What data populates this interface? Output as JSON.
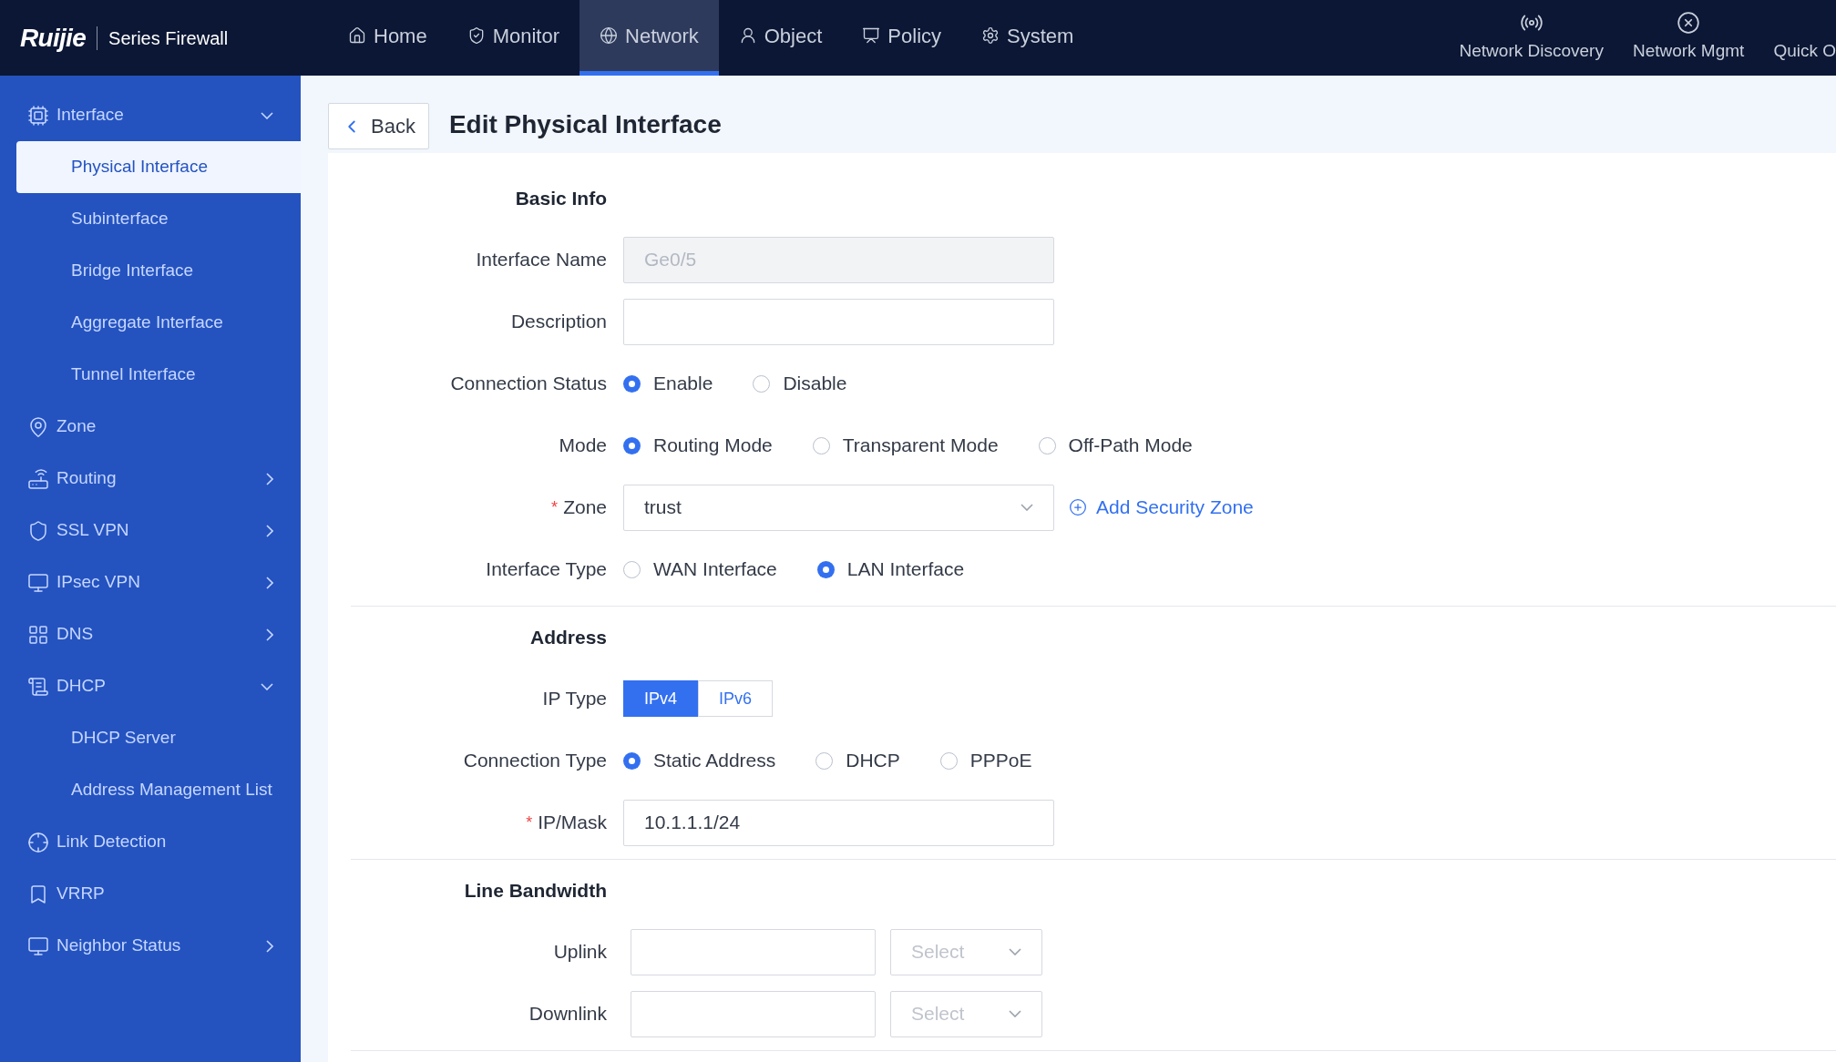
{
  "header": {
    "logo": "Ruijie",
    "product": "Series Firewall"
  },
  "nav_tabs": [
    {
      "label": "Home",
      "selected": false
    },
    {
      "label": "Monitor",
      "selected": false
    },
    {
      "label": "Network",
      "selected": true
    },
    {
      "label": "Object",
      "selected": false
    },
    {
      "label": "Policy",
      "selected": false
    },
    {
      "label": "System",
      "selected": false
    }
  ],
  "tools": [
    {
      "label": "Network Discovery"
    },
    {
      "label": "Network Mgmt"
    },
    {
      "label": "Quick O"
    }
  ],
  "sidebar": {
    "items": [
      {
        "label": "Interface",
        "kind": "menu",
        "expanded": true,
        "selected": false,
        "children": [
          {
            "label": "Physical Interface",
            "selected": true
          },
          {
            "label": "Subinterface",
            "selected": false
          },
          {
            "label": "Bridge Interface",
            "selected": false
          },
          {
            "label": "Aggregate Interface",
            "selected": false
          },
          {
            "label": "Tunnel Interface",
            "selected": false
          }
        ]
      },
      {
        "label": "Zone",
        "kind": "link",
        "selected": false
      },
      {
        "label": "Routing",
        "kind": "menu",
        "expanded": false,
        "selected": false
      },
      {
        "label": "SSL VPN",
        "kind": "menu",
        "expanded": false,
        "selected": false
      },
      {
        "label": "IPsec VPN",
        "kind": "menu",
        "expanded": false,
        "selected": false
      },
      {
        "label": "DNS",
        "kind": "menu",
        "expanded": false,
        "selected": false
      },
      {
        "label": "DHCP",
        "kind": "menu",
        "expanded": true,
        "selected": false,
        "children": [
          {
            "label": "DHCP Server",
            "selected": false
          },
          {
            "label": "Address Management List",
            "selected": false
          }
        ]
      },
      {
        "label": "Link Detection",
        "kind": "link",
        "selected": false
      },
      {
        "label": "VRRP",
        "kind": "link",
        "selected": false
      },
      {
        "label": "Neighbor Status",
        "kind": "menu",
        "expanded": false,
        "selected": false
      }
    ]
  },
  "page": {
    "back": "Back",
    "title": "Edit Physical Interface"
  },
  "sections": [
    {
      "title": "Basic Info",
      "fields": [
        {
          "kind": "text",
          "label": "Interface Name",
          "value": "Ge0/5",
          "disabled": true
        },
        {
          "kind": "text",
          "label": "Description",
          "disabled": false
        },
        {
          "kind": "radio",
          "label": "Connection Status",
          "options": [
            {
              "label": "Enable",
              "selected": true
            },
            {
              "label": "Disable",
              "selected": false
            }
          ]
        },
        {
          "kind": "radio",
          "label": "Mode",
          "options": [
            {
              "label": "Routing Mode",
              "selected": true
            },
            {
              "label": "Transparent Mode",
              "selected": false
            },
            {
              "label": "Off-Path Mode",
              "selected": false
            }
          ]
        },
        {
          "kind": "select",
          "label": "Zone",
          "required_mark": "*",
          "value": "trust",
          "link": "Add Security Zone"
        },
        {
          "kind": "radio",
          "label": "Interface Type",
          "options": [
            {
              "label": "WAN Interface",
              "selected": false
            },
            {
              "label": "LAN Interface",
              "selected": true
            }
          ]
        }
      ]
    },
    {
      "title": "Address",
      "fields": [
        {
          "kind": "segmented",
          "label": "IP Type",
          "options": [
            {
              "label": "IPv4",
              "selected": true
            },
            {
              "label": "IPv6",
              "selected": false
            }
          ]
        },
        {
          "kind": "radio",
          "label": "Connection Type",
          "options": [
            {
              "label": "Static Address",
              "selected": true
            },
            {
              "label": "DHCP",
              "selected": false
            },
            {
              "label": "PPPoE",
              "selected": false
            }
          ]
        },
        {
          "kind": "text",
          "label": "IP/Mask",
          "required_mark": "*",
          "value": "10.1.1.1/24",
          "disabled": false
        }
      ]
    },
    {
      "title": "Line Bandwidth",
      "fields": [
        {
          "kind": "bandwidth",
          "label": "Uplink",
          "placeholder": "Select"
        },
        {
          "kind": "bandwidth",
          "label": "Downlink",
          "placeholder": "Select"
        }
      ]
    }
  ]
}
